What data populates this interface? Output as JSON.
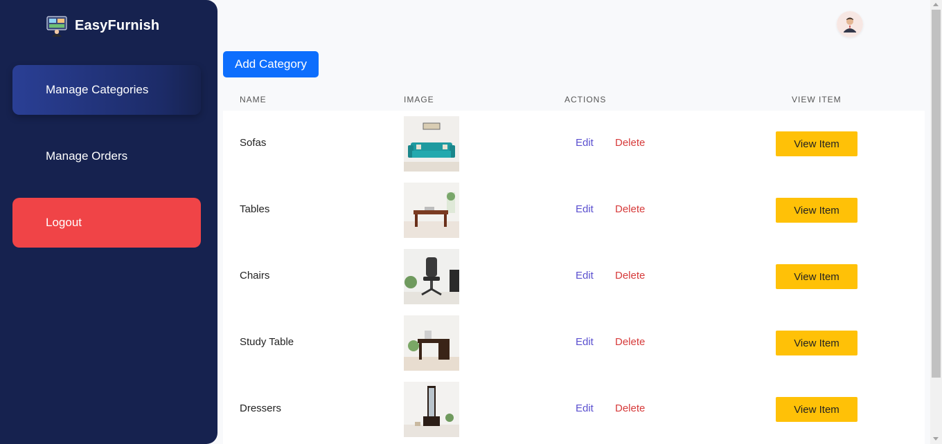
{
  "app": {
    "name": "EasyFurnish",
    "logo_icon": "furniture-monitor-logo"
  },
  "sidebar": {
    "items": [
      {
        "label": "Manage Categories",
        "active": true
      },
      {
        "label": "Manage Orders",
        "active": false
      },
      {
        "label": "Logout",
        "active": false
      }
    ]
  },
  "header": {
    "avatar_icon": "user-avatar"
  },
  "toolbar": {
    "add_label": "Add Category"
  },
  "table": {
    "headers": [
      "NAME",
      "IMAGE",
      "ACTIONS",
      "VIEW ITEM"
    ],
    "rows": [
      {
        "name": "Sofas",
        "edit": "Edit",
        "delete": "Delete",
        "view": "View Item",
        "image": "sofa-photo"
      },
      {
        "name": "Tables",
        "edit": "Edit",
        "delete": "Delete",
        "view": "View Item",
        "image": "table-photo"
      },
      {
        "name": "Chairs",
        "edit": "Edit",
        "delete": "Delete",
        "view": "View Item",
        "image": "chair-photo"
      },
      {
        "name": "Study Table",
        "edit": "Edit",
        "delete": "Delete",
        "view": "View Item",
        "image": "study-table-photo"
      },
      {
        "name": "Dressers",
        "edit": "Edit",
        "delete": "Delete",
        "view": "View Item",
        "image": "dresser-photo"
      }
    ]
  },
  "colors": {
    "sidebar_bg": "#16224f",
    "primary": "#0d6efd",
    "logout": "#f04447",
    "view_button": "#ffc107",
    "edit_link": "#5a4fcf",
    "delete_link": "#d63a3a"
  }
}
